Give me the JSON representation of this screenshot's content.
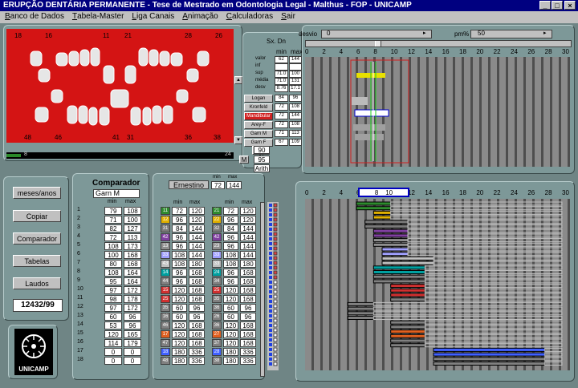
{
  "window": {
    "title": "ERUPÇÃO DENTÁRIA PERMANENTE - Tese de Mestrado em Odontologia Legal - Malthus - FOP - UNICAMP"
  },
  "menu": [
    {
      "pre": "",
      "u": "B",
      "post": "anco de Dados"
    },
    {
      "pre": "",
      "u": "T",
      "post": "abela-Master"
    },
    {
      "pre": "",
      "u": "L",
      "post": "iga Canais"
    },
    {
      "pre": "",
      "u": "A",
      "post": "nimação"
    },
    {
      "pre": "",
      "u": "C",
      "post": "alculadoras"
    },
    {
      "pre": "",
      "u": "S",
      "post": "air"
    }
  ],
  "dental": {
    "top_numbers": [
      "18",
      "16",
      "11",
      "21",
      "28",
      "26"
    ],
    "bottom_numbers": [
      "48",
      "46",
      "41",
      "31",
      "36",
      "38"
    ],
    "progress_left": "8",
    "progress_right": "24"
  },
  "side_buttons": {
    "percents": [
      "90 %",
      "95 %"
    ],
    "fem_masc": [
      "F",
      "M"
    ],
    "arith": "Arith"
  },
  "stats_table": {
    "header": [
      "Sx. Dn",
      "min",
      "max"
    ],
    "rows": [
      {
        "label": "valor",
        "min": "62",
        "max": "144"
      },
      {
        "label": "inf",
        "min": "",
        "max": ""
      },
      {
        "label": "sup",
        "min": "71.0",
        "max": "100"
      },
      {
        "label": "média",
        "min": "71.0",
        "max": "131"
      },
      {
        "label": "desv",
        "min": "8.76",
        "max": "17.1"
      }
    ],
    "methods": [
      {
        "label": "Logan",
        "min": "84",
        "max": "96"
      },
      {
        "label": "Kronfeld",
        "min": "72",
        "max": "108"
      },
      {
        "label": "Mandibular",
        "min": "72",
        "max": "144"
      },
      {
        "label": "Arey-F",
        "min": "72",
        "max": "108"
      },
      {
        "label": "Garn M",
        "min": "71",
        "max": "113"
      },
      {
        "label": "Garn F",
        "min": "67",
        "max": "109"
      }
    ]
  },
  "top_chart": {
    "desvio_label": "desvio",
    "desvio_value": "0",
    "pm_label": "pm%",
    "pm_value": "50",
    "ticks": [
      "0",
      "2",
      "4",
      "6",
      "8",
      "10",
      "12",
      "14",
      "16",
      "18",
      "20",
      "22",
      "24",
      "26",
      "28",
      "30"
    ]
  },
  "left_buttons": [
    "meses/anos",
    "Copiar",
    "Comparador",
    "Tabelas",
    "Laudos"
  ],
  "case_id": "12432/99",
  "logo_text": "UNICAMP",
  "comparador": {
    "title": "Comparador",
    "selected": "Garn M",
    "col_min": "min",
    "col_max": "max",
    "rows": [
      {
        "n": "1",
        "min": "79",
        "max": "108"
      },
      {
        "n": "2",
        "min": "71",
        "max": "100"
      },
      {
        "n": "3",
        "min": "82",
        "max": "127"
      },
      {
        "n": "4",
        "min": "72",
        "max": "113"
      },
      {
        "n": "5",
        "min": "108",
        "max": "173"
      },
      {
        "n": "6",
        "min": "100",
        "max": "168"
      },
      {
        "n": "7",
        "min": "80",
        "max": "168"
      },
      {
        "n": "8",
        "min": "108",
        "max": "164"
      },
      {
        "n": "9",
        "min": "95",
        "max": "164"
      },
      {
        "n": "10",
        "min": "97",
        "max": "172"
      },
      {
        "n": "11",
        "min": "98",
        "max": "178"
      },
      {
        "n": "12",
        "min": "97",
        "max": "172"
      },
      {
        "n": "13",
        "min": "60",
        "max": "96"
      },
      {
        "n": "14",
        "min": "53",
        "max": "96"
      },
      {
        "n": "15",
        "min": "120",
        "max": "165"
      },
      {
        "n": "16",
        "min": "114",
        "max": "179"
      },
      {
        "n": "17",
        "min": "0",
        "max": "0"
      },
      {
        "n": "18",
        "min": "0",
        "max": "0"
      }
    ]
  },
  "ernestino": {
    "title": "Ernestino",
    "min_label": "min",
    "max_label": "max",
    "min": "72",
    "max": "144",
    "col_min": "min",
    "col_max": "max",
    "left": [
      {
        "t": "11",
        "c": "#2e8b2e",
        "min": "72",
        "max": "120"
      },
      {
        "t": "12",
        "c": "#e0b000",
        "min": "96",
        "max": "120"
      },
      {
        "t": "31",
        "c": "#7a7a7a",
        "min": "84",
        "max": "144"
      },
      {
        "t": "42",
        "c": "#8040a0",
        "min": "96",
        "max": "144"
      },
      {
        "t": "13",
        "c": "#909090",
        "min": "96",
        "max": "144"
      },
      {
        "t": "33",
        "c": "#a0a0ff",
        "min": "108",
        "max": "144"
      },
      {
        "t": "43",
        "c": "#c0c0c0",
        "min": "108",
        "max": "180"
      },
      {
        "t": "14",
        "c": "#00a0a0",
        "min": "96",
        "max": "168"
      },
      {
        "t": "44",
        "c": "#808080",
        "min": "96",
        "max": "168"
      },
      {
        "t": "15",
        "c": "#d03030",
        "min": "120",
        "max": "168"
      },
      {
        "t": "25",
        "c": "#d03030",
        "min": "120",
        "max": "168"
      },
      {
        "t": "35",
        "c": "#808080",
        "min": "60",
        "max": "96"
      },
      {
        "t": "16",
        "c": "#808080",
        "min": "60",
        "max": "96"
      },
      {
        "t": "46",
        "c": "#808080",
        "min": "120",
        "max": "168"
      },
      {
        "t": "17",
        "c": "#e06020",
        "min": "120",
        "max": "168"
      },
      {
        "t": "47",
        "c": "#808080",
        "min": "120",
        "max": "168"
      },
      {
        "t": "18",
        "c": "#4060ff",
        "min": "180",
        "max": "336"
      },
      {
        "t": "48",
        "c": "#808080",
        "min": "180",
        "max": "336"
      }
    ],
    "right": [
      {
        "t": "21",
        "c": "#2e8b2e",
        "min": "72",
        "max": "120"
      },
      {
        "t": "22",
        "c": "#e0b000",
        "min": "96",
        "max": "120"
      },
      {
        "t": "32",
        "c": "#7a7a7a",
        "min": "84",
        "max": "144"
      },
      {
        "t": "42",
        "c": "#8040a0",
        "min": "96",
        "max": "144"
      },
      {
        "t": "23",
        "c": "#909090",
        "min": "96",
        "max": "144"
      },
      {
        "t": "33",
        "c": "#a0a0ff",
        "min": "108",
        "max": "144"
      },
      {
        "t": "33",
        "c": "#c0c0c0",
        "min": "108",
        "max": "180"
      },
      {
        "t": "24",
        "c": "#00a0a0",
        "min": "96",
        "max": "168"
      },
      {
        "t": "34",
        "c": "#808080",
        "min": "96",
        "max": "168"
      },
      {
        "t": "25",
        "c": "#d03030",
        "min": "120",
        "max": "168"
      },
      {
        "t": "35",
        "c": "#808080",
        "min": "120",
        "max": "168"
      },
      {
        "t": "36",
        "c": "#808080",
        "min": "60",
        "max": "96"
      },
      {
        "t": "26",
        "c": "#808080",
        "min": "60",
        "max": "96"
      },
      {
        "t": "36",
        "c": "#808080",
        "min": "120",
        "max": "168"
      },
      {
        "t": "27",
        "c": "#e06020",
        "min": "120",
        "max": "168"
      },
      {
        "t": "37",
        "c": "#808080",
        "min": "120",
        "max": "168"
      },
      {
        "t": "28",
        "c": "#4060ff",
        "min": "180",
        "max": "336"
      },
      {
        "t": "38",
        "c": "#808080",
        "min": "180",
        "max": "336"
      }
    ]
  },
  "bottom_chart": {
    "ticks": [
      "0",
      "2",
      "4",
      "6",
      "8",
      "10",
      "12",
      "14",
      "16",
      "18",
      "20",
      "22",
      "24",
      "26",
      "28",
      "30"
    ],
    "range_start": "8",
    "range_end": "10"
  }
}
